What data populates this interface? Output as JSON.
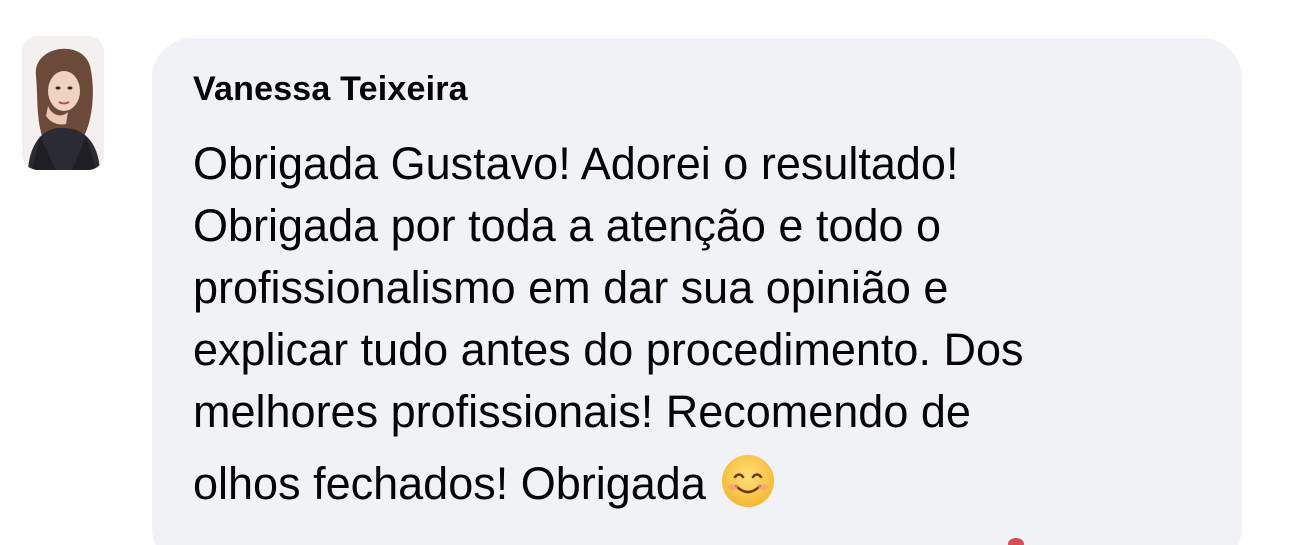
{
  "comment": {
    "author": "Vanessa Teixeira",
    "message_lines": [
      "Obrigada Gustavo! Adorei o resultado!",
      "Obrigada por toda a atenção e todo o",
      "profissionalismo em dar sua opinião e",
      "explicar tudo antes do procedimento. Dos",
      "melhores profissionais! Recomendo de",
      "olhos fechados! Obrigada"
    ],
    "emoji": "smiling-face-emoji",
    "avatar": "user-avatar-photo"
  },
  "colors": {
    "bubble_background": "#f0f2f5",
    "text": "#050505",
    "emoji_face": "#f9c63b"
  }
}
